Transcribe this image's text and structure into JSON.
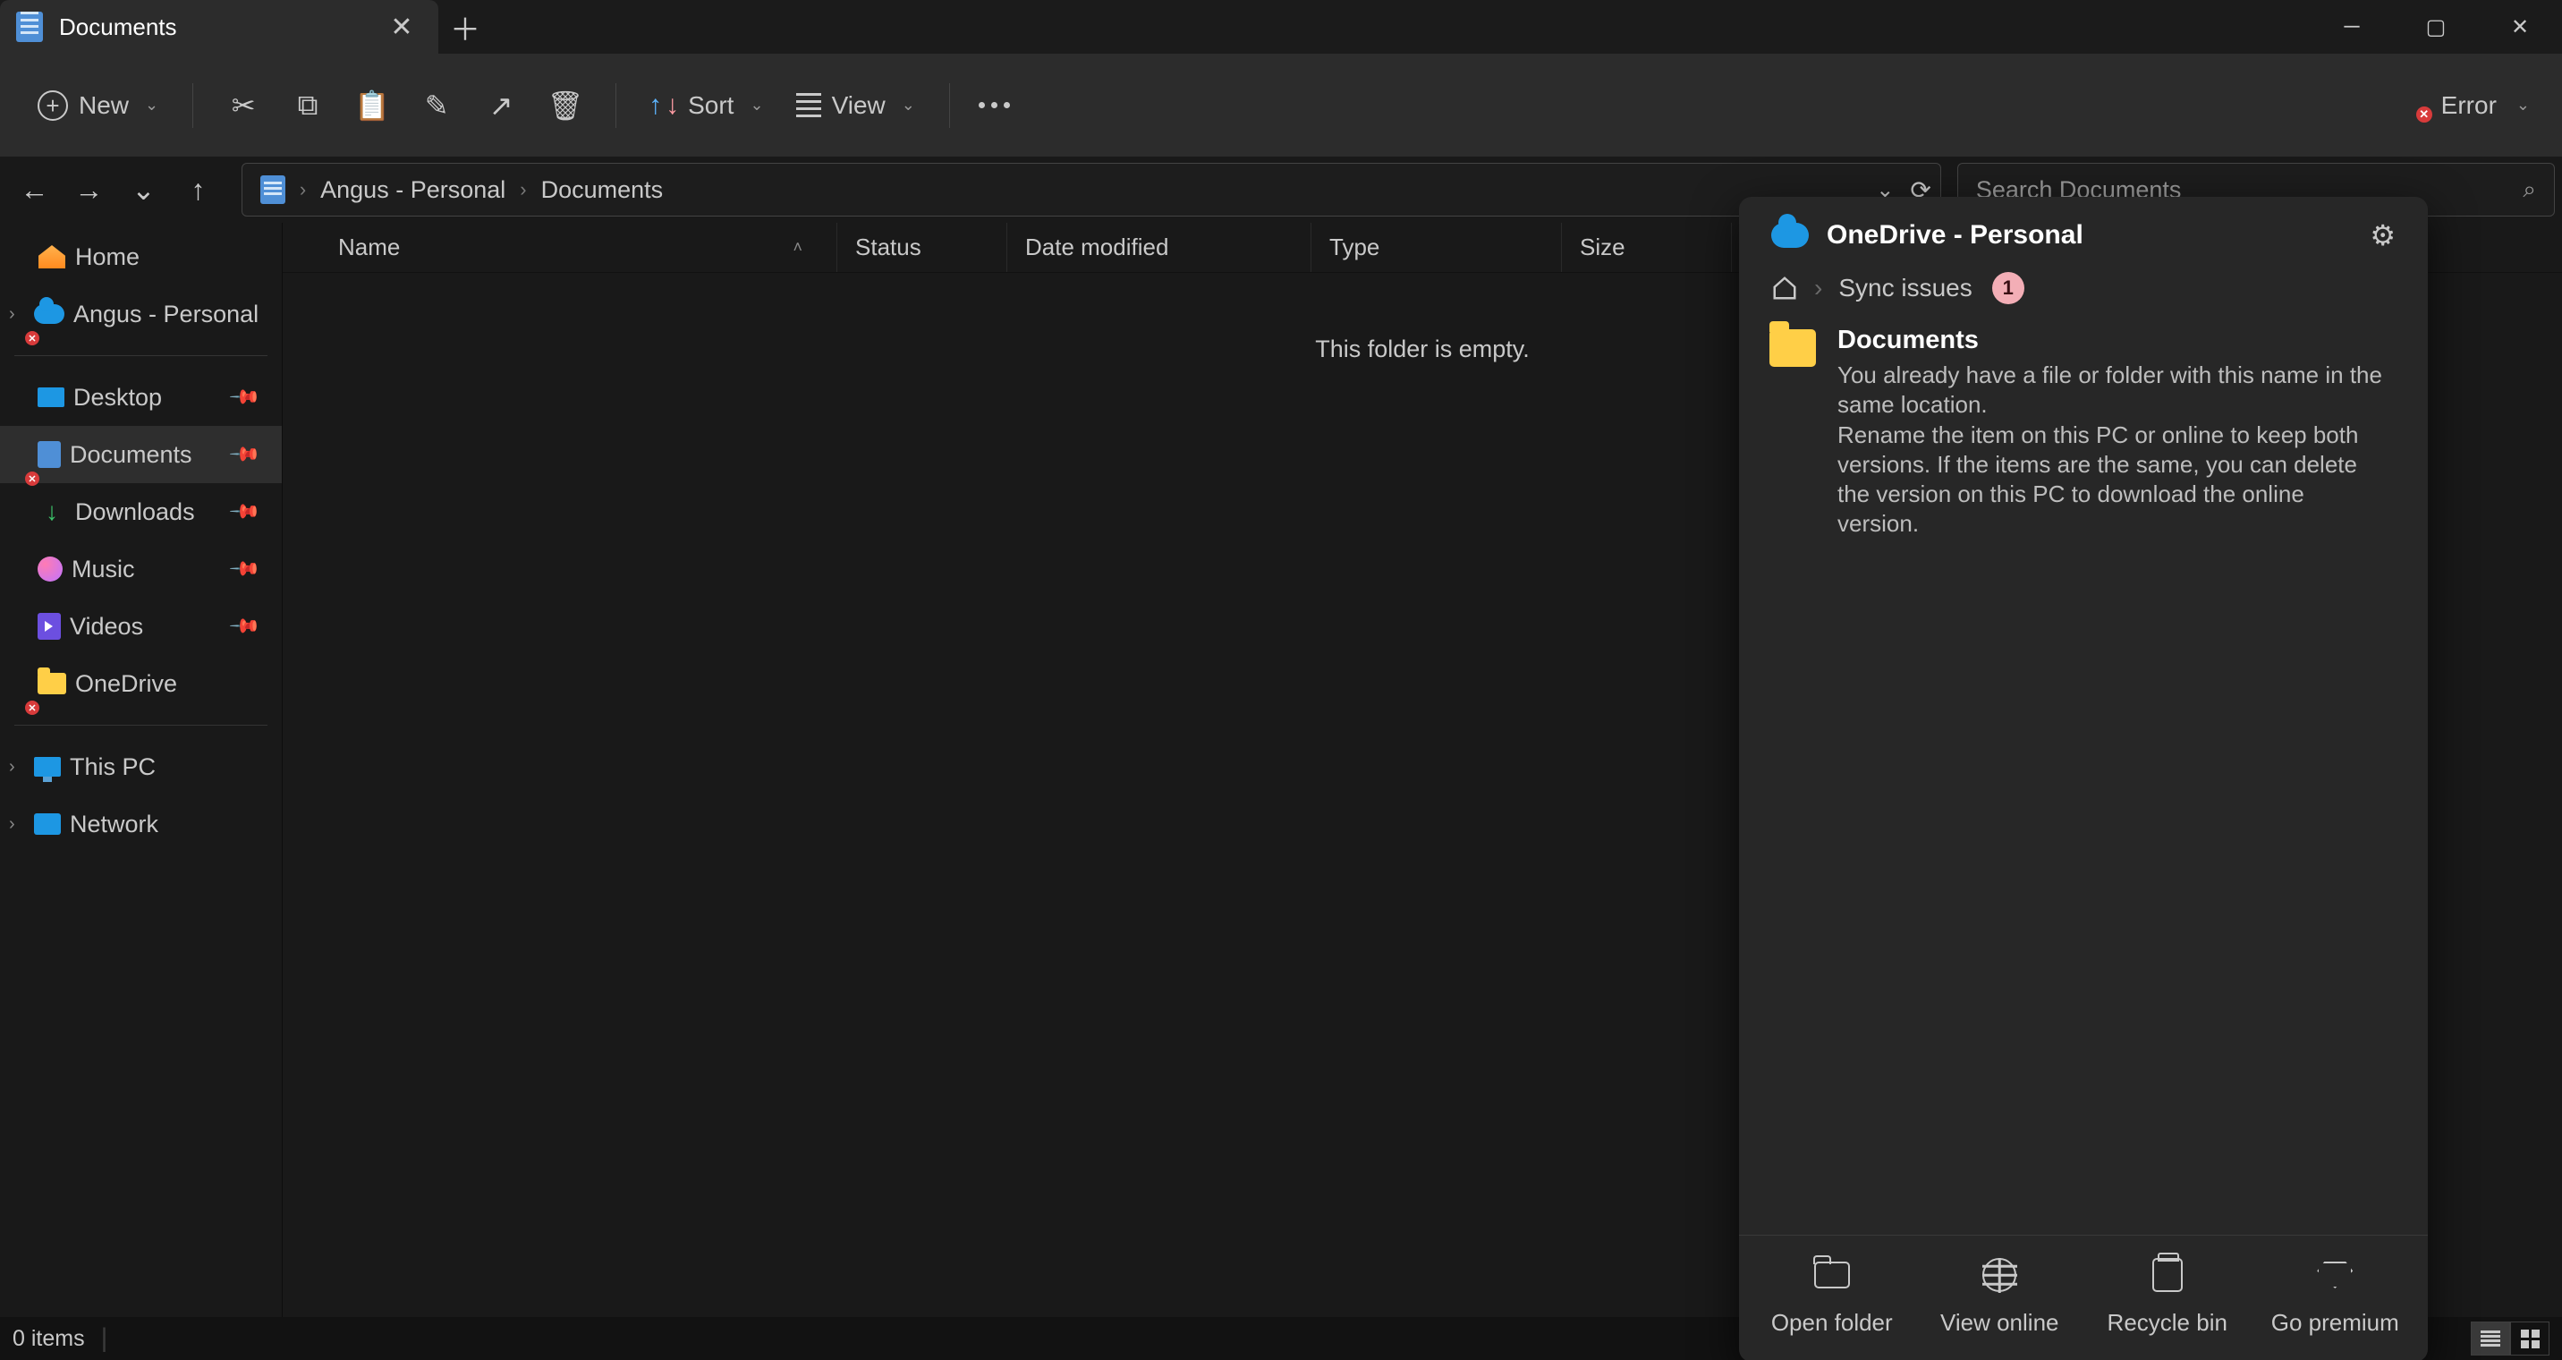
{
  "tab": {
    "title": "Documents"
  },
  "toolbar": {
    "new": "New",
    "sort": "Sort",
    "view": "View",
    "error": "Error"
  },
  "breadcrumbs": [
    "Angus - Personal",
    "Documents"
  ],
  "search": {
    "placeholder": "Search Documents"
  },
  "sidebar": {
    "home": "Home",
    "onedrive_account": "Angus - Personal",
    "desktop": "Desktop",
    "documents": "Documents",
    "downloads": "Downloads",
    "music": "Music",
    "videos": "Videos",
    "onedrive": "OneDrive",
    "thispc": "This PC",
    "network": "Network"
  },
  "columns": {
    "name": "Name",
    "status": "Status",
    "date": "Date modified",
    "type": "Type",
    "size": "Size"
  },
  "empty_msg": "This folder is empty.",
  "status": {
    "items": "0 items"
  },
  "flyout": {
    "title": "OneDrive - Personal",
    "crumb": "Sync issues",
    "badge": "1",
    "item_name": "Documents",
    "item_msg_1": "You already have a file or folder with this name in the same location.",
    "item_msg_2": "Rename the item on this PC or online to keep both versions. If the items are the same, you can delete the version on this PC to download the online version.",
    "actions": {
      "open": "Open folder",
      "view": "View online",
      "bin": "Recycle bin",
      "premium": "Go premium"
    }
  }
}
